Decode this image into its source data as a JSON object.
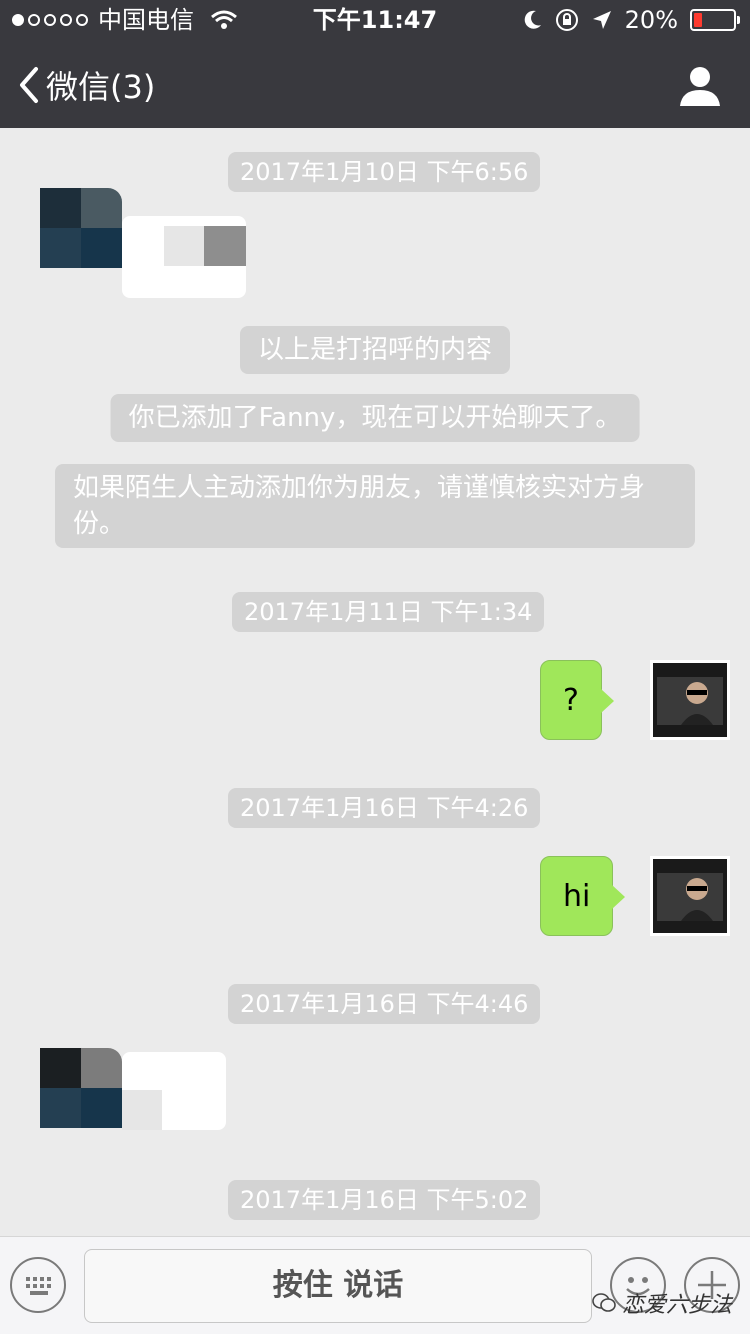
{
  "status": {
    "carrier": "中国电信",
    "time": "下午11:47",
    "battery_pct": "20%",
    "battery_level": 0.2,
    "battery_color": "#ff3b30"
  },
  "nav": {
    "back_label": "微信(3)"
  },
  "messages": {
    "t1": "2017年1月10日 下午6:56",
    "sys1": "以上是打招呼的内容",
    "sys2": "你已添加了Fanny，现在可以开始聊天了。",
    "sys3": "如果陌生人主动添加你为朋友，请谨慎核实对方身份。",
    "t2": "2017年1月11日 下午1:34",
    "me1": "?",
    "t3": "2017年1月16日 下午4:26",
    "me2": "hi",
    "t4": "2017年1月16日 下午4:46",
    "t5": "2017年1月16日 下午5:02"
  },
  "input": {
    "hold_to_talk": "按住 说话"
  },
  "watermark": "恋爱六步法",
  "colors": {
    "topbar": "#39393e",
    "my_bubble": "#a0e75a",
    "chat_bg": "#ebebeb"
  }
}
